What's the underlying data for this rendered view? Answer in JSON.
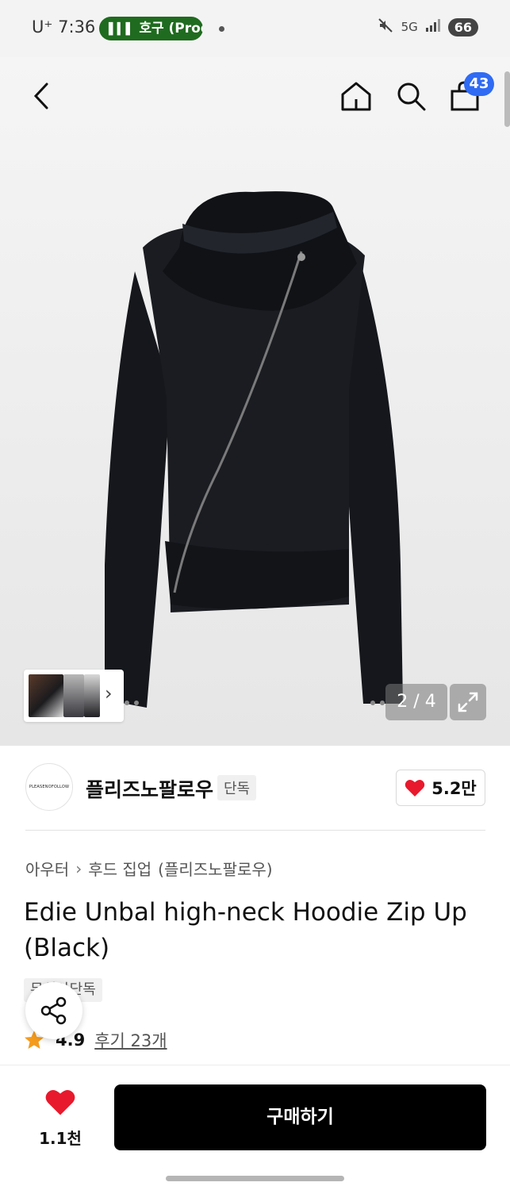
{
  "status_bar": {
    "carrier": "U⁺ 7:36",
    "call_chip": "호구 (Prod",
    "network": "5G",
    "battery": "66"
  },
  "top_bar": {
    "cart_badge": "43"
  },
  "gallery": {
    "counter": "2 / 4"
  },
  "brand": {
    "logo_text": "PLEASENOFOLLOW",
    "name": "플리즈노팔로우",
    "tag": "단독",
    "like_count": "5.2만"
  },
  "product": {
    "breadcrumb": [
      "아우터",
      "후드 집업",
      "(플리즈노팔로우)"
    ],
    "title": "Edie Unbal high-neck Hoodie Zip Up (Black)",
    "exclusive_tag": "무신사단독",
    "rating": "4.9",
    "review_link": "후기 23개"
  },
  "bottom_bar": {
    "wish_count": "1.1천",
    "buy_label": "구매하기"
  },
  "colors": {
    "accent_blue": "#2f6bf3",
    "heart_red": "#e8192c",
    "star_orange": "#f59b1c",
    "call_green": "#1f6b1f"
  }
}
